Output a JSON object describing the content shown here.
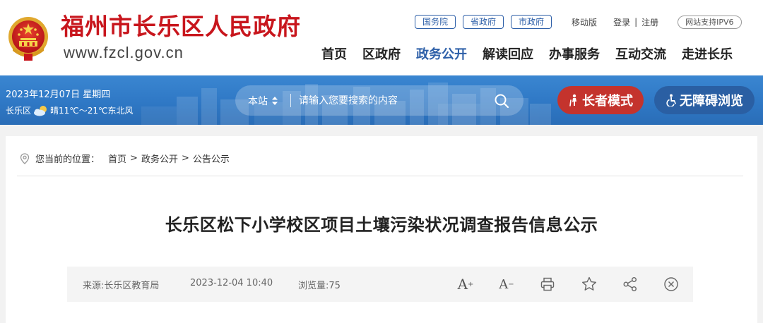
{
  "header": {
    "site_title": "福州市长乐区人民政府",
    "site_url": "www.fzcl.gov.cn",
    "gov_links": [
      "国务院",
      "省政府",
      "市政府"
    ],
    "utility": {
      "mobile": "移动版",
      "login": "登录",
      "separator": "|",
      "register": "注册",
      "ipv6": "网站支持IPV6"
    },
    "nav": [
      {
        "label": "首页",
        "active": false
      },
      {
        "label": "区政府",
        "active": false
      },
      {
        "label": "政务公开",
        "active": true
      },
      {
        "label": "解读回应",
        "active": false
      },
      {
        "label": "办事服务",
        "active": false
      },
      {
        "label": "互动交流",
        "active": false
      },
      {
        "label": "走进长乐",
        "active": false
      }
    ]
  },
  "banner": {
    "date": "2023年12月07日 星期四",
    "district": "长乐区",
    "weather": "晴11℃～21℃东北风",
    "weather_icon": "sun-cloud-icon",
    "search": {
      "scope": "本站",
      "placeholder": "请输入您要搜索的内容"
    },
    "elder_mode": "长者模式",
    "accessibility": "无障碍浏览"
  },
  "breadcrumb": {
    "prefix": "您当前的位置：",
    "items": [
      "首页",
      "政务公开",
      "公告公示"
    ],
    "separator": ">"
  },
  "article": {
    "title": "长乐区松下小学校区项目土壤污染状况调查报告信息公示",
    "source": "来源:长乐区教育局",
    "date": "2023-12-04 10:40",
    "views": "浏览量:75",
    "tools": {
      "font_larger": "A",
      "font_larger_sign": "+",
      "font_smaller": "A",
      "font_smaller_sign": "−"
    }
  },
  "colors": {
    "brand_red": "#c8161d",
    "nav_active_blue": "#2d5fa8",
    "banner_blue": "#2f78c5",
    "elder_button_red": "#c4332d",
    "access_button_blue": "#2a5fa3"
  }
}
